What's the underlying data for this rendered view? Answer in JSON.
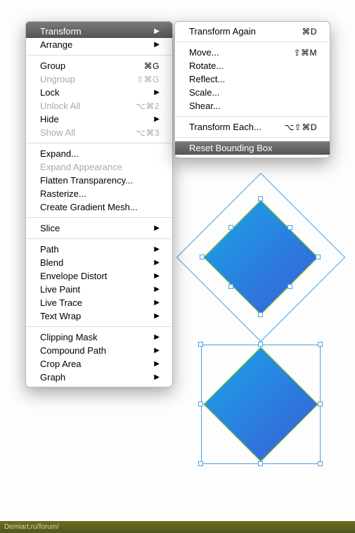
{
  "mainMenu": [
    {
      "label": "Transform",
      "shortcut": "",
      "arrow": true,
      "state": "highlight"
    },
    {
      "label": "Arrange",
      "shortcut": "",
      "arrow": true
    },
    {
      "sep": true
    },
    {
      "label": "Group",
      "shortcut": "⌘G"
    },
    {
      "label": "Ungroup",
      "shortcut": "⇧⌘G",
      "disabled": true
    },
    {
      "label": "Lock",
      "shortcut": "",
      "arrow": true
    },
    {
      "label": "Unlock All",
      "shortcut": "⌥⌘2",
      "disabled": true
    },
    {
      "label": "Hide",
      "shortcut": "",
      "arrow": true
    },
    {
      "label": "Show All",
      "shortcut": "⌥⌘3",
      "disabled": true
    },
    {
      "sep": true
    },
    {
      "label": "Expand..."
    },
    {
      "label": "Expand Appearance",
      "disabled": true
    },
    {
      "label": "Flatten Transparency..."
    },
    {
      "label": "Rasterize..."
    },
    {
      "label": "Create Gradient Mesh..."
    },
    {
      "sep": true
    },
    {
      "label": "Slice",
      "arrow": true
    },
    {
      "sep": true
    },
    {
      "label": "Path",
      "arrow": true
    },
    {
      "label": "Blend",
      "arrow": true
    },
    {
      "label": "Envelope Distort",
      "arrow": true
    },
    {
      "label": "Live Paint",
      "arrow": true
    },
    {
      "label": "Live Trace",
      "arrow": true
    },
    {
      "label": "Text Wrap",
      "arrow": true
    },
    {
      "sep": true
    },
    {
      "label": "Clipping Mask",
      "arrow": true
    },
    {
      "label": "Compound Path",
      "arrow": true
    },
    {
      "label": "Crop Area",
      "arrow": true
    },
    {
      "label": "Graph",
      "arrow": true
    }
  ],
  "subMenu": [
    {
      "label": "Transform Again",
      "shortcut": "⌘D"
    },
    {
      "sep": true
    },
    {
      "label": "Move...",
      "shortcut": "⇧⌘M"
    },
    {
      "label": "Rotate..."
    },
    {
      "label": "Reflect..."
    },
    {
      "label": "Scale..."
    },
    {
      "label": "Shear..."
    },
    {
      "sep": true
    },
    {
      "label": "Transform Each...",
      "shortcut": "⌥⇧⌘D"
    },
    {
      "sep": true
    },
    {
      "label": "Reset Bounding Box",
      "state": "highlight"
    }
  ],
  "footer": "Demiart.ru/forum/",
  "shapes": {
    "gradientStart": "#19a0e6",
    "gradientEnd": "#3c5fd8",
    "stroke": "#7fc22e",
    "selectionColor": "#4aa0e8"
  }
}
